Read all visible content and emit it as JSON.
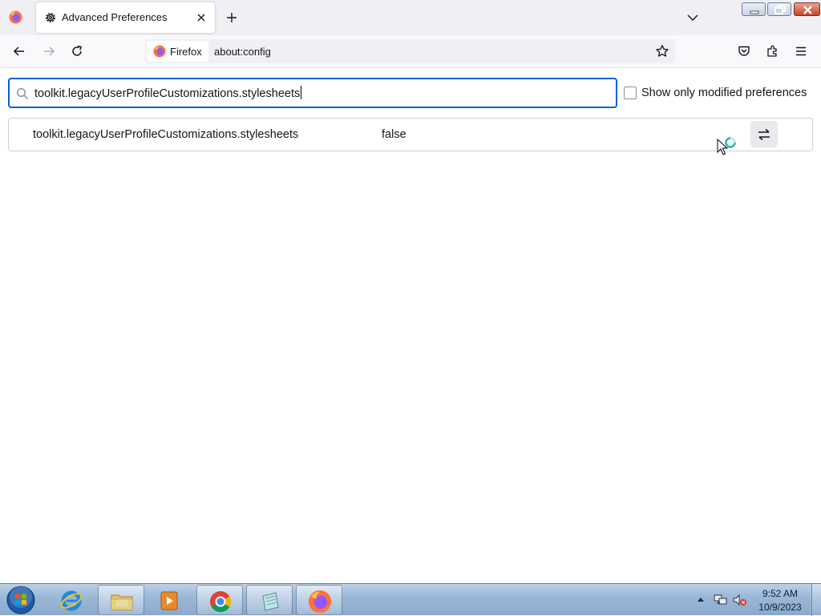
{
  "tab": {
    "title": "Advanced Preferences"
  },
  "urlbar": {
    "identity_label": "Firefox",
    "url": "about:config"
  },
  "search": {
    "value": "toolkit.legacyUserProfileCustomizations.stylesheets"
  },
  "filter": {
    "label": "Show only modified preferences",
    "checked": false
  },
  "preferences": [
    {
      "name": "toolkit.legacyUserProfileCustomizations.stylesheets",
      "value": "false"
    }
  ],
  "taskbar": {
    "items": [
      "internet-explorer",
      "windows-explorer",
      "media-player",
      "chrome",
      "notepad",
      "firefox"
    ],
    "clock": {
      "time": "9:52 AM",
      "date": "10/9/2023"
    }
  },
  "colors": {
    "accent": "#0061e0",
    "firefox_orange": "#ff7139",
    "firefox_purple": "#7542e5"
  }
}
